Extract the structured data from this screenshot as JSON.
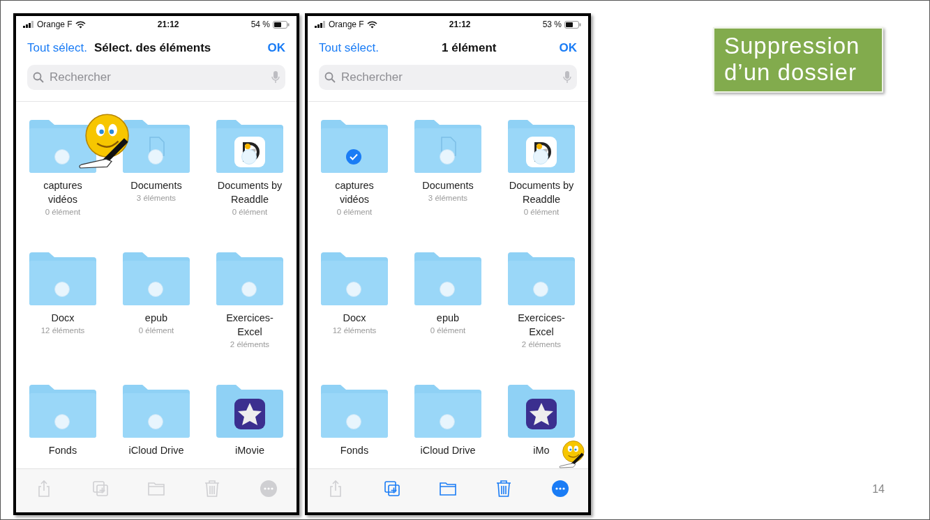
{
  "phones": [
    {
      "status": {
        "carrier": "Orange F",
        "time": "21:12",
        "battery": "54 %"
      },
      "nav": {
        "select_all": "Tout sélect.",
        "title": "Sélect. des éléments",
        "done": "OK"
      },
      "search": {
        "placeholder": "Rechercher"
      },
      "items": [
        {
          "kind": "folder",
          "name": "captures vidéos",
          "count": "0 élément",
          "selected": false
        },
        {
          "kind": "document",
          "name": "Documents",
          "count": "3 éléments",
          "selected": false
        },
        {
          "kind": "readdle",
          "name": "Documents by Readdle",
          "count": "0 élément",
          "selected": false
        },
        {
          "kind": "folder",
          "name": "Docx",
          "count": "12 éléments",
          "selected": false
        },
        {
          "kind": "folder",
          "name": "epub",
          "count": "0 élément",
          "selected": false
        },
        {
          "kind": "folder",
          "name": "Exercices-Excel",
          "count": "2 éléments",
          "selected": false
        },
        {
          "kind": "folder",
          "name": "Fonds",
          "selected": false
        },
        {
          "kind": "folder",
          "name": "iCloud Drive",
          "selected": false
        },
        {
          "kind": "imovie",
          "name": "iMovie"
        }
      ],
      "toolbar": [
        {
          "kind": "share",
          "disabled": true
        },
        {
          "kind": "duplicate",
          "disabled": true
        },
        {
          "kind": "move",
          "disabled": true
        },
        {
          "kind": "trash",
          "disabled": true
        },
        {
          "kind": "more",
          "disabled": true
        }
      ]
    },
    {
      "status": {
        "carrier": "Orange F",
        "time": "21:12",
        "battery": "53 %"
      },
      "nav": {
        "select_all": "Tout sélect.",
        "title": "1 élément",
        "done": "OK"
      },
      "search": {
        "placeholder": "Rechercher"
      },
      "items": [
        {
          "kind": "folder",
          "name": "captures vidéos",
          "count": "0 élément",
          "selected": true
        },
        {
          "kind": "document",
          "name": "Documents",
          "count": "3 éléments",
          "selected": false
        },
        {
          "kind": "readdle",
          "name": "Documents by Readdle",
          "count": "0 élément",
          "selected": false
        },
        {
          "kind": "folder",
          "name": "Docx",
          "count": "12 éléments",
          "selected": false
        },
        {
          "kind": "folder",
          "name": "epub",
          "count": "0 élément",
          "selected": false
        },
        {
          "kind": "folder",
          "name": "Exercices-Excel",
          "count": "2 éléments",
          "selected": false
        },
        {
          "kind": "folder",
          "name": "Fonds",
          "selected": false
        },
        {
          "kind": "folder",
          "name": "iCloud Drive",
          "selected": false
        },
        {
          "kind": "imovie",
          "name": "iMo"
        }
      ],
      "toolbar": [
        {
          "kind": "share",
          "disabled": true
        },
        {
          "kind": "duplicate",
          "disabled": false
        },
        {
          "kind": "move",
          "disabled": false
        },
        {
          "kind": "trash",
          "disabled": false
        },
        {
          "kind": "more",
          "disabled": false
        }
      ]
    }
  ],
  "slide_title": "Suppression d’un dossier",
  "page_number": "14"
}
